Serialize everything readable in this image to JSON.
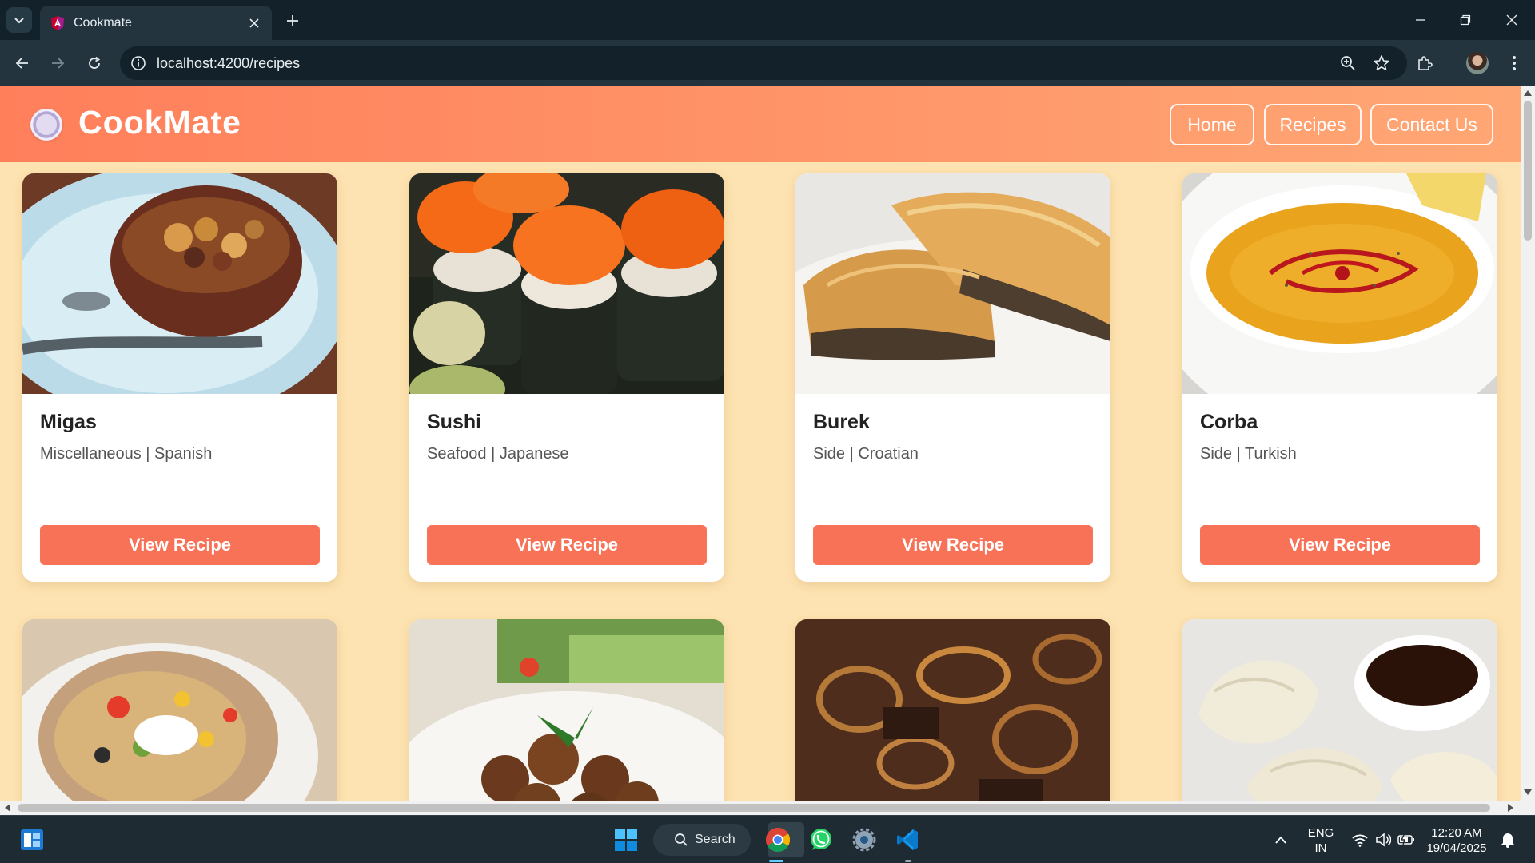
{
  "browser": {
    "tab_title": "Cookmate",
    "url": "localhost:4200/recipes"
  },
  "app": {
    "logo_text": "CookMate",
    "nav": [
      {
        "label": "Home"
      },
      {
        "label": "Recipes"
      },
      {
        "label": "Contact Us"
      }
    ]
  },
  "recipes": [
    {
      "name": "Migas",
      "meta": "Miscellaneous | Spanish",
      "button": "View Recipe",
      "image": "migas-photo"
    },
    {
      "name": "Sushi",
      "meta": "Seafood | Japanese",
      "button": "View Recipe",
      "image": "sushi-photo"
    },
    {
      "name": "Burek",
      "meta": "Side | Croatian",
      "button": "View Recipe",
      "image": "burek-photo"
    },
    {
      "name": "Corba",
      "meta": "Side | Turkish",
      "button": "View Recipe",
      "image": "corba-photo"
    }
  ],
  "partial_recipes": [
    {
      "image": "stuffed-potato-photo"
    },
    {
      "image": "falafel-photo"
    },
    {
      "image": "beef-onions-photo"
    },
    {
      "image": "dumplings-photo"
    }
  ],
  "taskbar": {
    "search_label": "Search",
    "lang_top": "ENG",
    "lang_bottom": "IN",
    "time": "12:20 AM",
    "date": "19/04/2025"
  },
  "colors": {
    "header_start": "#ff7f5b",
    "header_end": "#ffa774",
    "page_bg": "#fde3b1",
    "button": "#f77256"
  }
}
